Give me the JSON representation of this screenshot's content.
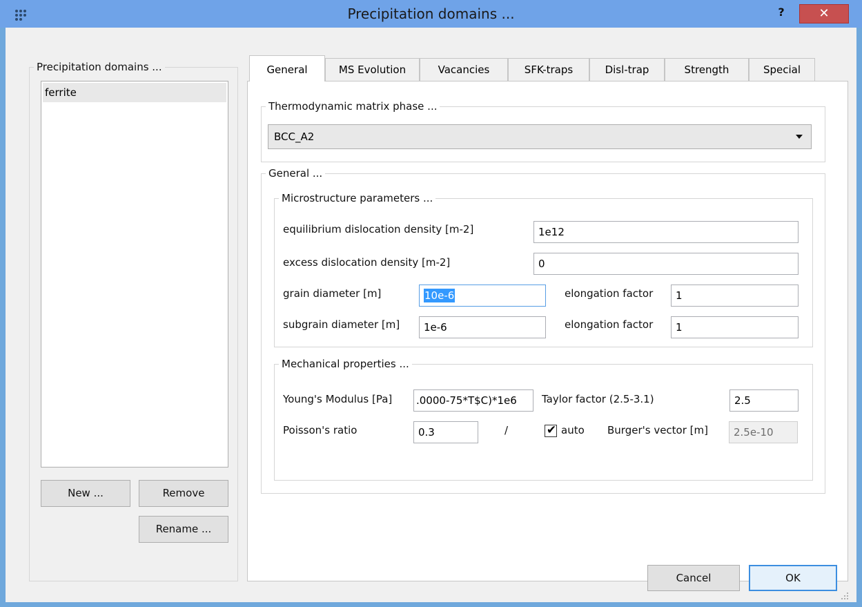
{
  "window": {
    "title": "Precipitation domains ...",
    "help_label": "?",
    "close_label": "✕"
  },
  "left_panel": {
    "group_title": "Precipitation domains ...",
    "items": [
      {
        "label": "ferrite",
        "selected": true
      }
    ],
    "new_label": "New ...",
    "remove_label": "Remove",
    "rename_label": "Rename ..."
  },
  "tabs": [
    {
      "label": "General",
      "active": true
    },
    {
      "label": "MS Evolution",
      "active": false
    },
    {
      "label": "Vacancies",
      "active": false
    },
    {
      "label": "SFK-traps",
      "active": false
    },
    {
      "label": "Disl-trap",
      "active": false
    },
    {
      "label": "Strength",
      "active": false
    },
    {
      "label": "Special",
      "active": false
    }
  ],
  "general_tab": {
    "matrix_group_title": "Thermodynamic matrix phase ...",
    "matrix_phase_value": "BCC_A2",
    "general_group_title": "General ...",
    "micro": {
      "title": "Microstructure parameters ...",
      "equilibrium_label": "equilibrium dislocation density  [m-2]",
      "equilibrium_value": "1e12",
      "excess_label": "excess dislocation density [m-2]",
      "excess_value": "0",
      "grain_label": "grain diameter [m]",
      "grain_value": "10e-6",
      "grain_elong_label": "elongation factor",
      "grain_elong_value": "1",
      "subgrain_label": "subgrain diameter [m]",
      "subgrain_value": "1e-6",
      "subgrain_elong_label": "elongation factor",
      "subgrain_elong_value": "1"
    },
    "mech": {
      "title": "Mechanical properties ...",
      "youngs_label": "Young's Modulus [Pa]",
      "youngs_value": ".0000-75*T$C)*1e6",
      "taylor_label": "Taylor factor (2.5-3.1)",
      "taylor_value": "2.5",
      "poisson_label": "Poisson's ratio",
      "poisson_value": "0.3",
      "slash": "/",
      "auto_checked": true,
      "auto_label": "auto",
      "burgers_label": "Burger's vector [m]",
      "burgers_value": "2.5e-10"
    }
  },
  "footer": {
    "cancel_label": "Cancel",
    "ok_label": "OK"
  },
  "colors": {
    "titlebar": "#6fa3e8",
    "close_button": "#c75050",
    "selection": "#3399ff"
  }
}
